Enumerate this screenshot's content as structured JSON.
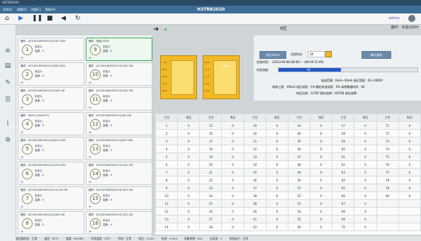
{
  "window": {
    "title": "H3TRB2020",
    "titlebar_text": "H3TRB2020"
  },
  "menu": [
    "文件(F)",
    "视图(V)",
    "控制(C)",
    "帮助(H)"
  ],
  "toolbar": {
    "user": "admin"
  },
  "sidebar": [
    "home-icon",
    "list-icon",
    "edit-icon",
    "settings-icon",
    "chart-icon",
    "gear-icon"
  ],
  "devices": [
    {
      "header": "器件：A22302483945101|24V-150II",
      "num": "1",
      "l1": "未定义",
      "l2": "温度：0",
      "foot": "◔"
    },
    {
      "header": "器件：刻检|192H",
      "num": "9",
      "l1": "未定义",
      "l2": "温度：0",
      "foot": "◔"
    },
    {
      "header": "器件：A22302483945101|36V-1601",
      "num": "2",
      "l1": "未定义",
      "l2": "温度：0",
      "foot": "◔"
    },
    {
      "header": "器件：A22302483945101|200V-16I",
      "num": "10",
      "l1": "未定义",
      "l2": "温度：0",
      "foot": "◔"
    },
    {
      "header": "器件：A22302483945101|316V-16I",
      "num": "3",
      "l1": "未定义",
      "l2": "温度：0",
      "foot": "◔"
    },
    {
      "header": "器件：A22302483945101|240V-16I",
      "num": "11",
      "l1": "未定义",
      "l2": "温度：0",
      "foot": "◔"
    },
    {
      "header": "器件：600V-100049/T1",
      "num": "4",
      "l1": "未定义",
      "l2": "温度：0",
      "foot": "◔"
    },
    {
      "header": "器件：A22302483945101|40V-16I",
      "num": "12",
      "l1": "未定义",
      "l2": "温度：0",
      "foot": "◔"
    },
    {
      "header": "器件：A22302483945101|80V-150II",
      "num": "5",
      "l1": "未定义",
      "l2": "温度：0",
      "foot": "◔"
    },
    {
      "header": "器件：A22302483945101|60V-160I",
      "num": "13",
      "l1": "未定义",
      "l2": "温度：0",
      "foot": "◔"
    },
    {
      "header": "器件：A22302483945101|120V-50II",
      "num": "6",
      "l1": "未定义",
      "l2": "温度：0",
      "foot": "◔"
    },
    {
      "header": "器件：A22302483945101|150V-16I",
      "num": "14",
      "l1": "未定义",
      "l2": "温度：0",
      "foot": "◔"
    },
    {
      "header": "器件：A22302483945101|110-5V-16I",
      "num": "7",
      "l1": "未定义",
      "l2": "温度：0",
      "foot": "◔"
    },
    {
      "header": "器件：A22302483945101|180V-16I",
      "num": "15",
      "l1": "未定义",
      "l2": "温度：0",
      "foot": "◔"
    },
    {
      "header": "器件：A22302483945101|220V-16I",
      "num": "8",
      "l1": "未定义",
      "l2": "温度：0",
      "foot": "◔"
    },
    {
      "header": "器件：A22302483945101|720V-16I",
      "num": "16",
      "l1": "未定义",
      "l2": "温度：0",
      "foot": "◔"
    }
  ],
  "gauges": [
    {
      "ticks": [
        "96",
        "88.8",
        "80.0",
        "72.3",
        "64.8"
      ]
    },
    {
      "ticks": [
        "35.0",
        "31.2",
        "27.6",
        "23.9",
        "20.2"
      ],
      "label": "温度(℃)"
    }
  ],
  "info": {
    "zone": "9区",
    "device": "器件：实验192H",
    "start_label": "实验 None",
    "test_time_label": "试验时长：",
    "test_time_value": "16",
    "confirm": "确认查询",
    "date_label": "实验时间：",
    "date_value": "(2023-09-08 08:49) ~ (08-09 15:49)",
    "progress_label": "实验进度：",
    "progress_value": "45",
    "progress_fraction": 0.45,
    "line1": "电流范围：0mA~30mA    电压范围：0V~2000V",
    "line2": "电流上限：100uA    电压误差：5%    额定电流误差：5%    采样数据时间：60",
    "line3": "电压比例：12787    模式选择：H3TRB    老化选择：  "
  },
  "table": {
    "headers": [
      "工位",
      "电压",
      "工位",
      "电压",
      "工位",
      "电压",
      "工位",
      "电压",
      "工位",
      "电压",
      "工位",
      "电压"
    ],
    "rows": [
      [
        "1",
        "0",
        "15",
        "0",
        "29",
        "0",
        "43",
        "0",
        "57",
        "0",
        "71",
        "0"
      ],
      [
        "2",
        "0",
        "16",
        "0",
        "30",
        "0",
        "44",
        "0",
        "58",
        "0",
        "72",
        "0"
      ],
      [
        "3",
        "0",
        "17",
        "0",
        "31",
        "0",
        "45",
        "0",
        "59",
        "0",
        "73",
        "0"
      ],
      [
        "4",
        "0",
        "18",
        "0",
        "32",
        "0",
        "46",
        "0",
        "60",
        "0",
        "74",
        "0"
      ],
      [
        "5",
        "0",
        "19",
        "0",
        "33",
        "0",
        "47",
        "0",
        "61",
        "0",
        "75",
        "0"
      ],
      [
        "6",
        "0",
        "20",
        "0",
        "34",
        "0",
        "48",
        "0",
        "62",
        "0",
        "76",
        "0"
      ],
      [
        "7",
        "0",
        "21",
        "0",
        "35",
        "0",
        "49",
        "0",
        "63",
        "0",
        "77",
        "0"
      ],
      [
        "8",
        "0",
        "22",
        "0",
        "36",
        "0",
        "50",
        "0",
        "64",
        "0",
        "78",
        "0"
      ],
      [
        "9",
        "0",
        "23",
        "0",
        "37",
        "0",
        "51",
        "0",
        "65",
        "0",
        "79",
        "0"
      ],
      [
        "10",
        "0",
        "24",
        "0",
        "38",
        "0",
        "52",
        "0",
        "66",
        "0",
        "80",
        "0"
      ],
      [
        "11",
        "0",
        "25",
        "0",
        "39",
        "0",
        "53",
        "0",
        "67",
        "0",
        "",
        ""
      ],
      [
        "12",
        "0",
        "26",
        "0",
        "40",
        "0",
        "54",
        "0",
        "68",
        "0",
        "",
        ""
      ],
      [
        "13",
        "0",
        "27",
        "0",
        "41",
        "0",
        "55",
        "0",
        "69",
        "0",
        "",
        ""
      ],
      [
        "14",
        "0",
        "28",
        "0",
        "42",
        "0",
        "56",
        "0",
        "70",
        "0",
        "",
        ""
      ]
    ]
  },
  "status": [
    "温控器状态：正常",
    "温控：85℃",
    "湿度：85%RH",
    "环境温度：29℃",
    "供电：正常",
    "电压：0.00V",
    "电流：0.000",
    "采集周期：60s",
    "总电流：0",
    "系统运行：正常"
  ]
}
